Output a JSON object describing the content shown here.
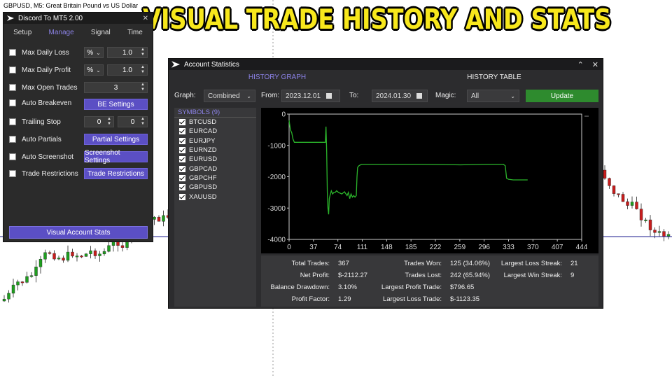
{
  "background": {
    "title": "GBPUSD, M5:  Great Britain Pound vs US Dollar"
  },
  "banner": "Visual Trade History and Stats",
  "panel": {
    "title": "Discord To MT5 2.00",
    "tabs": [
      "Setup",
      "Manage",
      "Signal",
      "Time"
    ],
    "active_tab": "Manage",
    "rows": {
      "max_daily_loss": {
        "label": "Max Daily Loss",
        "unit": "%",
        "value": "1.0"
      },
      "max_daily_profit": {
        "label": "Max Daily Profit",
        "unit": "%",
        "value": "1.0"
      },
      "max_open_trades": {
        "label": "Max Open Trades",
        "value": "3"
      },
      "auto_breakeven": {
        "label": "Auto Breakeven",
        "button": "BE Settings"
      },
      "trailing_stop": {
        "label": "Trailing Stop",
        "value1": "0",
        "value2": "0"
      },
      "auto_partials": {
        "label": "Auto Partials",
        "button": "Partial Settings"
      },
      "auto_screenshot": {
        "label": "Auto Screenshot",
        "button": "Screenshot Settings"
      },
      "trade_restrictions": {
        "label": "Trade Restrictions",
        "button": "Trade Restrictions"
      }
    },
    "bottom_button": "Visual Account Stats"
  },
  "window": {
    "title": "Account Statistics",
    "tabs": [
      "HISTORY GRAPH",
      "HISTORY TABLE"
    ],
    "controls": {
      "graph_label": "Graph:",
      "graph_value": "Combined",
      "from_label": "From:",
      "from_value": "2023.12.01",
      "to_label": "To:",
      "to_value": "2024.01.30",
      "magic_label": "Magic:",
      "magic_value": "All",
      "update_label": "Update"
    },
    "symbols_header": "SYMBOLS (9)",
    "symbols": [
      "BTCUSD",
      "EURCAD",
      "EURJPY",
      "EURNZD",
      "EURUSD",
      "GBPCAD",
      "GBPCHF",
      "GBPUSD",
      "XAUUSD"
    ],
    "stats": {
      "total_trades": {
        "label": "Total Trades:",
        "value": "367"
      },
      "net_profit": {
        "label": "Net Profit:",
        "value": "$-2112.27"
      },
      "balance_drawdown": {
        "label": "Balance Drawdown:",
        "value": "3.10%"
      },
      "profit_factor": {
        "label": "Profit Factor:",
        "value": "1.29"
      },
      "trades_won": {
        "label": "Trades Won:",
        "value": "125 (34.06%)"
      },
      "trades_lost": {
        "label": "Trades Lost:",
        "value": "242 (65.94%)"
      },
      "largest_profit_trade": {
        "label": "Largest Profit Trade:",
        "value": "$796.65"
      },
      "largest_loss_trade": {
        "label": "Largest Loss Trade:",
        "value": "$-1123.35"
      },
      "largest_loss_streak": {
        "label": "Largest Loss Streak:",
        "value": "21"
      },
      "largest_win_streak": {
        "label": "Largest Win Streak:",
        "value": "9"
      }
    }
  },
  "chart_data": {
    "type": "line",
    "x_ticks": [
      "0",
      "37",
      "74",
      "111",
      "148",
      "185",
      "222",
      "259",
      "296",
      "333",
      "370",
      "407",
      "444"
    ],
    "y_ticks": [
      "0",
      "-1000",
      "-2000",
      "-3000",
      "-4000"
    ],
    "xlim": [
      0,
      444
    ],
    "ylim": [
      -4000,
      0
    ],
    "series": [
      {
        "color": "#2bb52b",
        "points": [
          [
            0,
            -200
          ],
          [
            2,
            -500
          ],
          [
            4,
            -600
          ],
          [
            6,
            -800
          ],
          [
            8,
            -900
          ],
          [
            20,
            -900
          ],
          [
            40,
            -900
          ],
          [
            55,
            -900
          ],
          [
            56,
            -400
          ],
          [
            57,
            -1200
          ],
          [
            58,
            -2500
          ],
          [
            59,
            -3000
          ],
          [
            60,
            -3200
          ],
          [
            61,
            -2700
          ],
          [
            62,
            -2600
          ],
          [
            64,
            -2450
          ],
          [
            66,
            -2550
          ],
          [
            68,
            -2500
          ],
          [
            70,
            -2500
          ],
          [
            72,
            -2450
          ],
          [
            75,
            -2500
          ],
          [
            80,
            -2550
          ],
          [
            84,
            -2480
          ],
          [
            88,
            -2600
          ],
          [
            90,
            -2500
          ],
          [
            92,
            -2700
          ],
          [
            94,
            -2550
          ],
          [
            96,
            -2650
          ],
          [
            98,
            -2600
          ],
          [
            100,
            -2650
          ],
          [
            102,
            -2600
          ],
          [
            103,
            -2000
          ],
          [
            104,
            -1700
          ],
          [
            106,
            -1650
          ],
          [
            110,
            -1600
          ],
          [
            150,
            -1600
          ],
          [
            200,
            -1600
          ],
          [
            260,
            -1620
          ],
          [
            300,
            -1600
          ],
          [
            325,
            -1600
          ],
          [
            328,
            -1650
          ],
          [
            330,
            -2050
          ],
          [
            333,
            -2080
          ],
          [
            340,
            -2100
          ],
          [
            355,
            -2100
          ],
          [
            362,
            -2100
          ]
        ]
      }
    ]
  }
}
